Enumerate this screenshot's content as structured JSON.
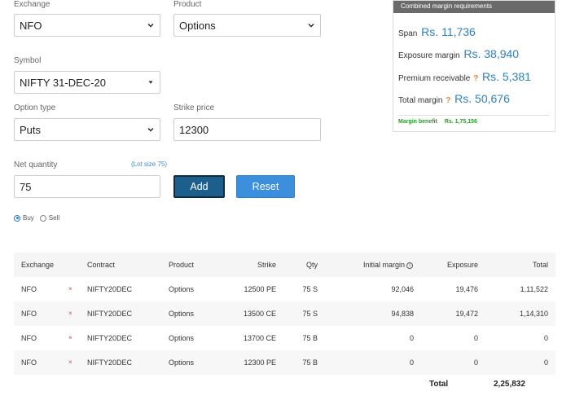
{
  "form": {
    "exchange": {
      "label": "Exchange",
      "value": "NFO"
    },
    "product": {
      "label": "Product",
      "value": "Options"
    },
    "symbol": {
      "label": "Symbol",
      "value": "NIFTY 31-DEC-20"
    },
    "option_type": {
      "label": "Option type",
      "value": "Puts"
    },
    "strike_price": {
      "label": "Strike price",
      "value": "12300"
    },
    "net_quantity": {
      "label": "Net quantity",
      "value": "75"
    },
    "lot_size": "(Lot size 75)",
    "add_label": "Add",
    "reset_label": "Reset",
    "buy_label": "Buy",
    "sell_label": "Sell",
    "buy_selected": true
  },
  "margin": {
    "title": "Combined margin requirements",
    "span": {
      "label": "Span",
      "value": "Rs. 11,736"
    },
    "exposure": {
      "label": "Exposure margin",
      "value": "Rs. 38,940"
    },
    "premium": {
      "label": "Premium receivable",
      "q": "?",
      "value": "Rs. 5,381"
    },
    "total": {
      "label": "Total margin",
      "q": "?",
      "value": "Rs. 50,676"
    },
    "benefit": {
      "label": "Margin benefit",
      "value": "Rs. 1,75,156"
    }
  },
  "table": {
    "headers": {
      "exchange": "Exchange",
      "contract": "Contract",
      "product": "Product",
      "strike": "Strike",
      "qty": "Qty",
      "initial_margin": "Initial margin",
      "exposure": "Exposure",
      "total": "Total"
    },
    "rows": [
      {
        "exchange": "NFO",
        "remove": "×",
        "contract": "NIFTY20DEC",
        "product": "Options",
        "strike": "12500 PE",
        "qty": "75 S",
        "initial_margin": "92,046",
        "exposure": "19,476",
        "total": "1,11,522"
      },
      {
        "exchange": "NFO",
        "remove": "×",
        "contract": "NIFTY20DEC",
        "product": "Options",
        "strike": "13500 CE",
        "qty": "75 S",
        "initial_margin": "94,838",
        "exposure": "19,472",
        "total": "1,14,310"
      },
      {
        "exchange": "NFO",
        "remove": "×",
        "contract": "NIFTY20DEC",
        "product": "Options",
        "strike": "13700 CE",
        "qty": "75 B",
        "initial_margin": "0",
        "exposure": "0",
        "total": "0"
      },
      {
        "exchange": "NFO",
        "remove": "×",
        "contract": "NIFTY20DEC",
        "product": "Options",
        "strike": "12300 PE",
        "qty": "75 B",
        "initial_margin": "0",
        "exposure": "0",
        "total": "0"
      }
    ],
    "total_label": "Total",
    "total_value": "2,25,832"
  },
  "icons": {
    "select_chevron": "chevron-down-icon",
    "info": "info-icon",
    "remove": "close-icon"
  },
  "colors": {
    "accent_blue": "#2e7fc4",
    "add_button": "#1d5f8c",
    "reset_button": "#3b8fdc",
    "benefit_green": "#1ea31e",
    "remove_red": "#e8443a",
    "help_orange": "#e8823a"
  }
}
